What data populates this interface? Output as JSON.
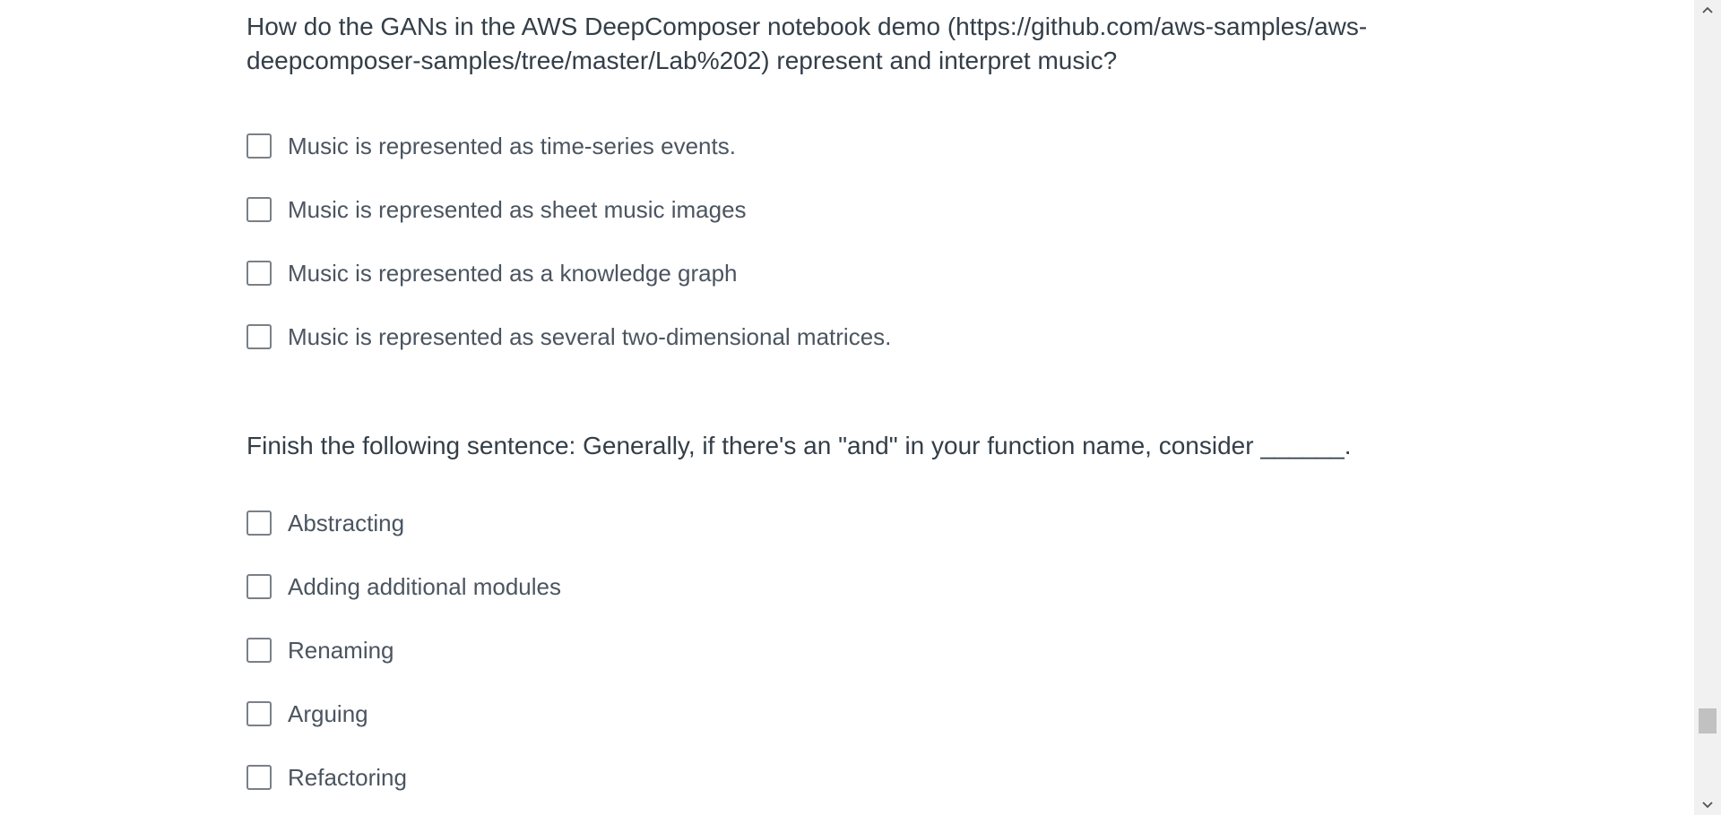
{
  "questions": [
    {
      "text": "How do the GANs in the AWS DeepComposer notebook demo (https://github.com/aws-samples/aws-deepcomposer-samples/tree/master/Lab%202) represent and interpret music?",
      "options": [
        "Music is represented as time-series events.",
        "Music is represented as sheet music images",
        "Music is represented as a knowledge graph",
        "Music is represented as several two-dimensional matrices."
      ]
    },
    {
      "text": "Finish the following sentence: Generally, if there's an \"and\" in your function name, consider ______.",
      "options": [
        "Abstracting",
        "Adding additional modules",
        "Renaming",
        "Arguing",
        "Refactoring"
      ]
    }
  ],
  "scrollbar": {
    "up_icon": "chevron-up-icon",
    "down_icon": "chevron-down-icon",
    "position": 0.89
  }
}
